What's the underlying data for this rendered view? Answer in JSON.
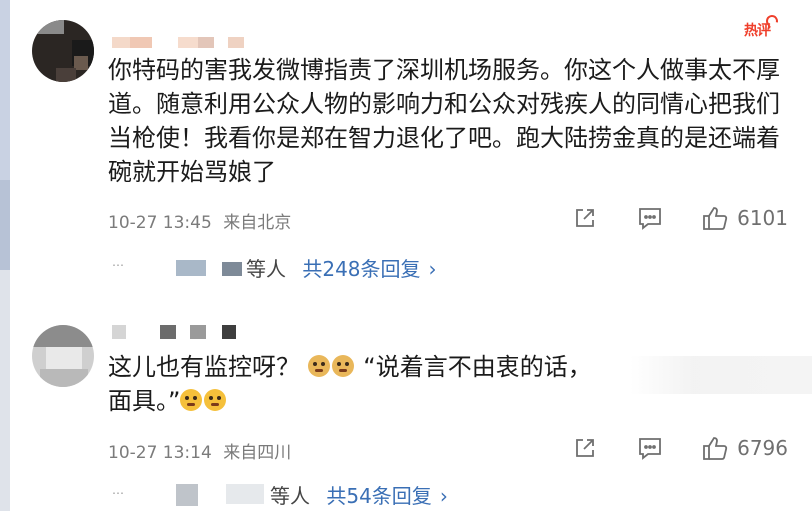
{
  "badge": {
    "hot": "热评"
  },
  "comments": [
    {
      "text": "你特码的害我发微博指责了深圳机场服务。你这个人做事太不厚道。随意利用公众人物的影响力和公众对残疾人的同情心把我们当枪使！我看你是郑在智力退化了吧。跑大陆捞金真的是还端着碗就开始骂娘了",
      "time": "10-27 13:45",
      "location": "来自北京",
      "likes": "6101",
      "reply_prefix": "等人",
      "reply_link": "共248条回复",
      "chevron": "›"
    },
    {
      "text_before": "这儿也有监控呀？",
      "text_quote": "“说着言不由衷的话，",
      "text_line2": "面具。”",
      "time": "10-27 13:14",
      "location": "来自四川",
      "likes": "6796",
      "reply_prefix": "等人",
      "reply_link": "共54条回复",
      "chevron": "›"
    }
  ],
  "icons": {
    "share": "share-icon",
    "comment": "comment-icon",
    "like": "thumbs-up-icon",
    "emoji_doge": "doge-emoji",
    "emoji_cry": "cry-emoji"
  }
}
